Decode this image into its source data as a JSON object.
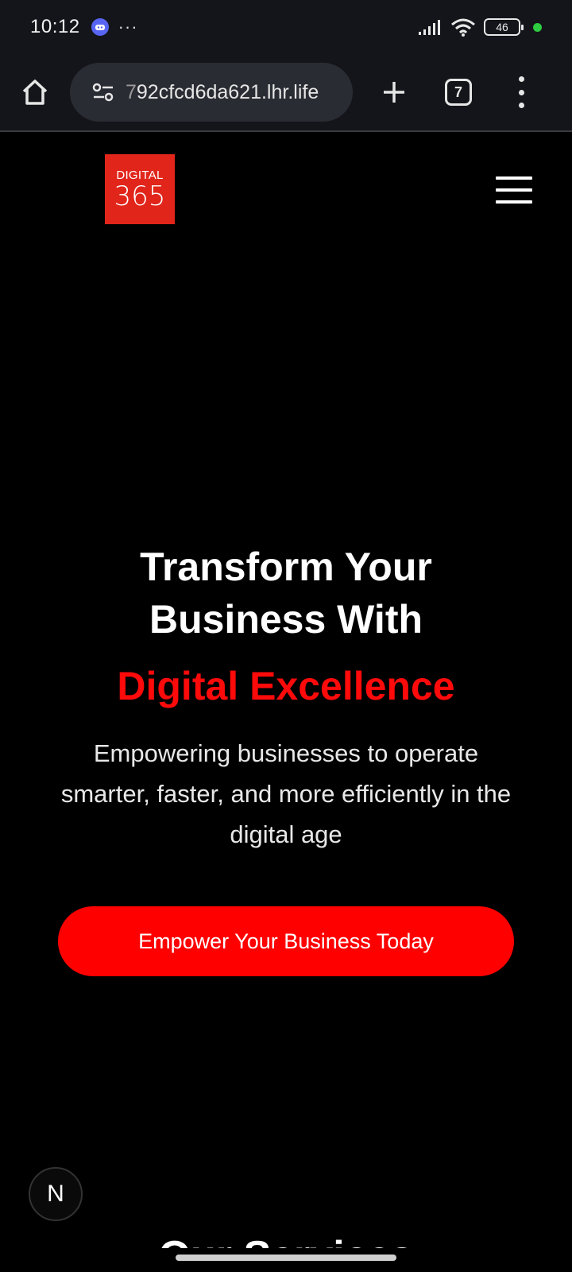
{
  "status_bar": {
    "time": "10:12",
    "more": "···",
    "battery": "46"
  },
  "browser": {
    "url_dim": "7",
    "url": "92cfcd6da621.lhr.life",
    "tab_count": "7"
  },
  "site": {
    "logo_top": "DIGITAL",
    "logo_bottom": "365"
  },
  "hero": {
    "title_line1": "Transform Your",
    "title_line2": "Business With",
    "accent": "Digital Excellence",
    "subtitle": "Empowering businesses to operate smarter, faster, and more efficiently in the digital age",
    "cta_label": "Empower Your Business Today"
  },
  "next_badge": "N",
  "services_heading": "Our Services",
  "colors": {
    "accent": "#ff0000",
    "logo_bg": "#e1251b",
    "bar_bg": "#14151a"
  }
}
